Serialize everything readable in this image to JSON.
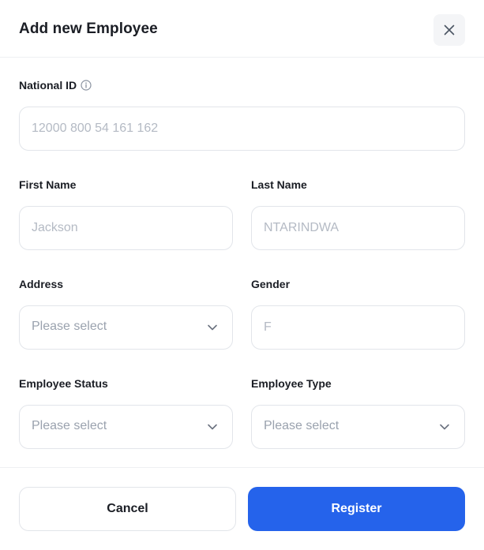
{
  "dialog": {
    "title": "Add new Employee"
  },
  "form": {
    "national_id": {
      "label": "National ID",
      "placeholder": "12000 800 54 161 162"
    },
    "first_name": {
      "label": "First Name",
      "placeholder": "Jackson"
    },
    "last_name": {
      "label": "Last Name",
      "placeholder": "NTARINDWA"
    },
    "address": {
      "label": "Address",
      "value": "Please select"
    },
    "gender": {
      "label": "Gender",
      "placeholder": "F"
    },
    "employee_status": {
      "label": "Employee Status",
      "value": "Please select"
    },
    "employee_type": {
      "label": "Employee Type",
      "value": "Please select"
    }
  },
  "actions": {
    "cancel_label": "Cancel",
    "register_label": "Register"
  },
  "colors": {
    "primary": "#2563eb",
    "border": "#e2e5ea",
    "placeholder": "#b4bac4"
  },
  "icons": {
    "close": "close-icon",
    "info": "info-icon",
    "dropdown": "chevron-down-icon"
  }
}
